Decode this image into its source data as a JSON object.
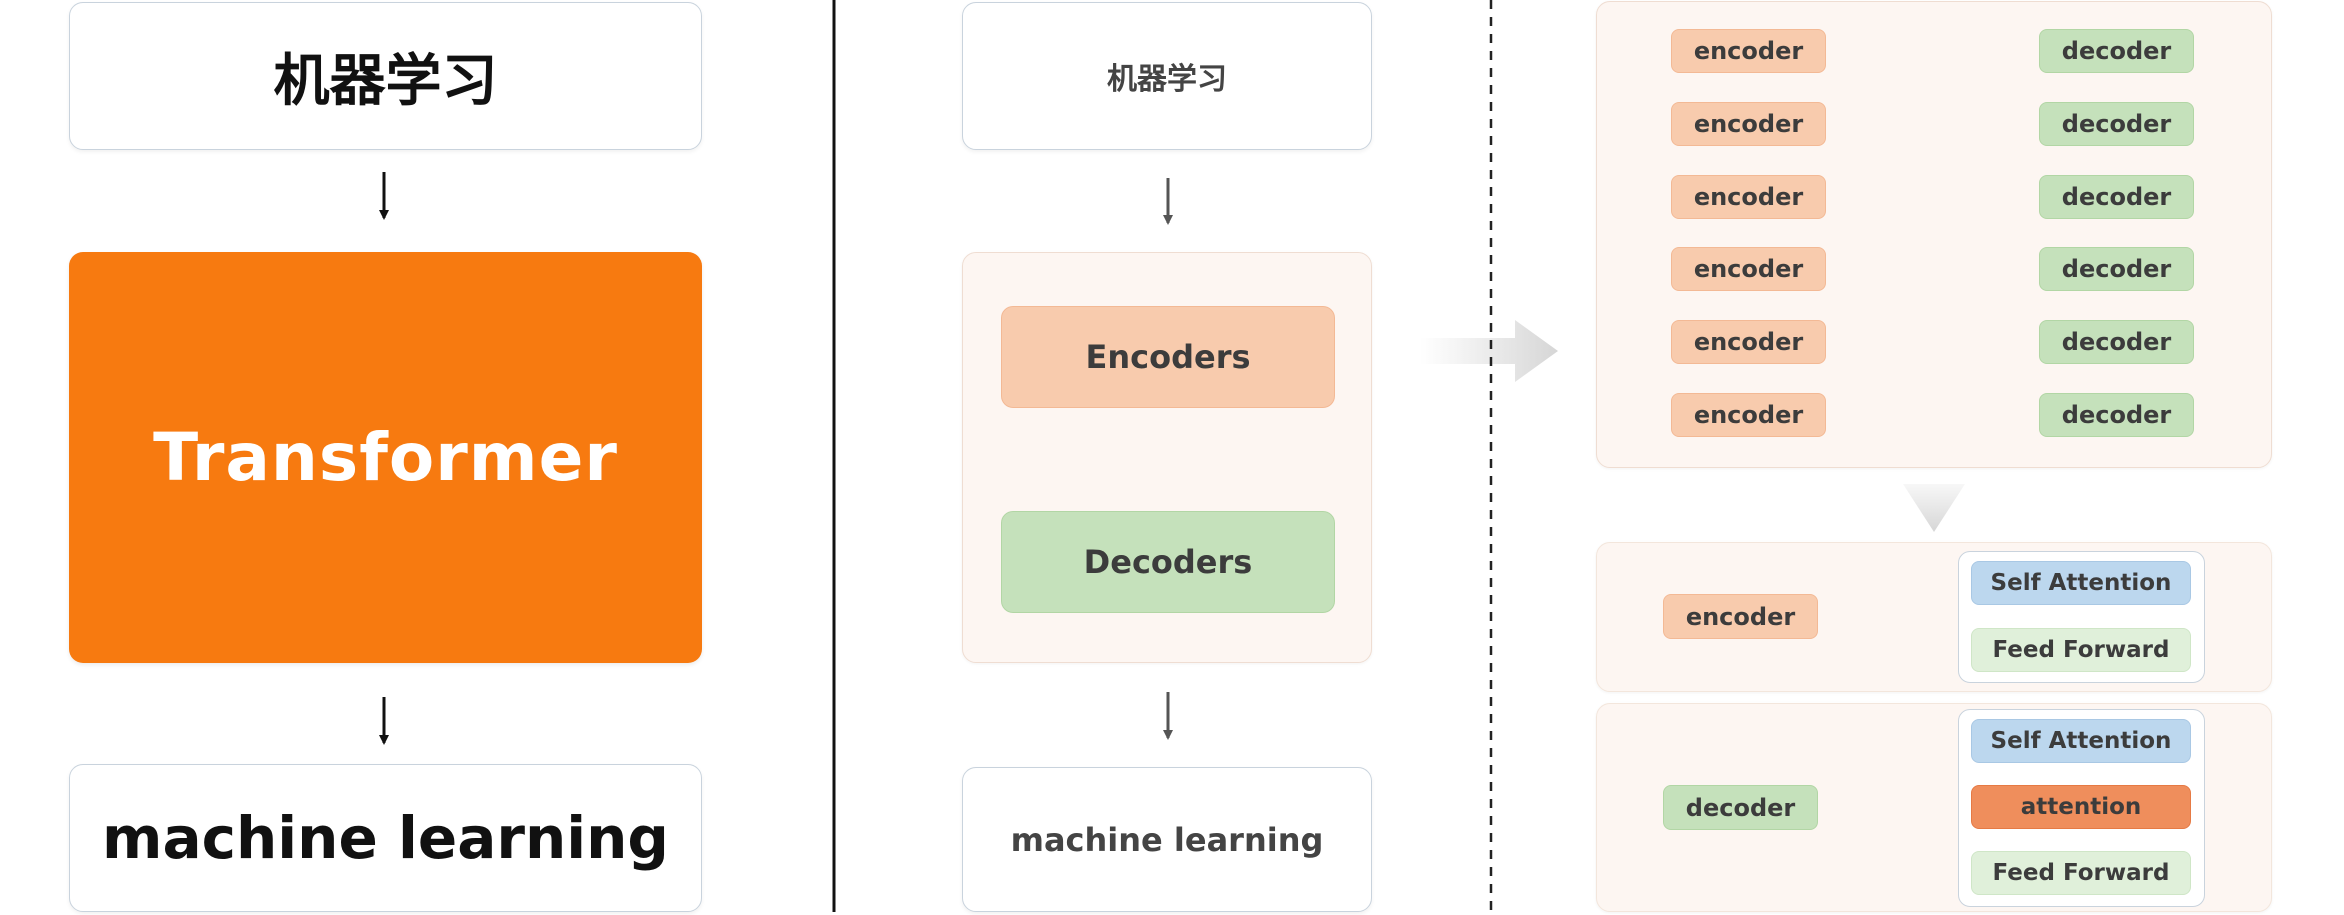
{
  "left": {
    "top_label": "机器学习",
    "center_label": "Transformer",
    "bottom_label": "machine learning"
  },
  "middle": {
    "top_label": "机器学习",
    "encoders_label": "Encoders",
    "decoders_label": "Decoders",
    "bottom_label": "machine learning"
  },
  "stack": {
    "encoders": [
      "encoder",
      "encoder",
      "encoder",
      "encoder",
      "encoder",
      "encoder"
    ],
    "decoders": [
      "decoder",
      "decoder",
      "decoder",
      "decoder",
      "decoder",
      "decoder"
    ]
  },
  "encoder_detail": {
    "label": "encoder",
    "layers": [
      "Self Attention",
      "Feed Forward"
    ]
  },
  "decoder_detail": {
    "label": "decoder",
    "layers": [
      "Self Attention",
      "attention",
      "Feed Forward"
    ]
  },
  "colors": {
    "orange": "#f77a10",
    "encoder": "#f8cbad",
    "decoder": "#c5e1bb",
    "self_attention": "#bcd7ee",
    "feed_forward": "#e0f0da",
    "attention": "#ef8e5c"
  }
}
